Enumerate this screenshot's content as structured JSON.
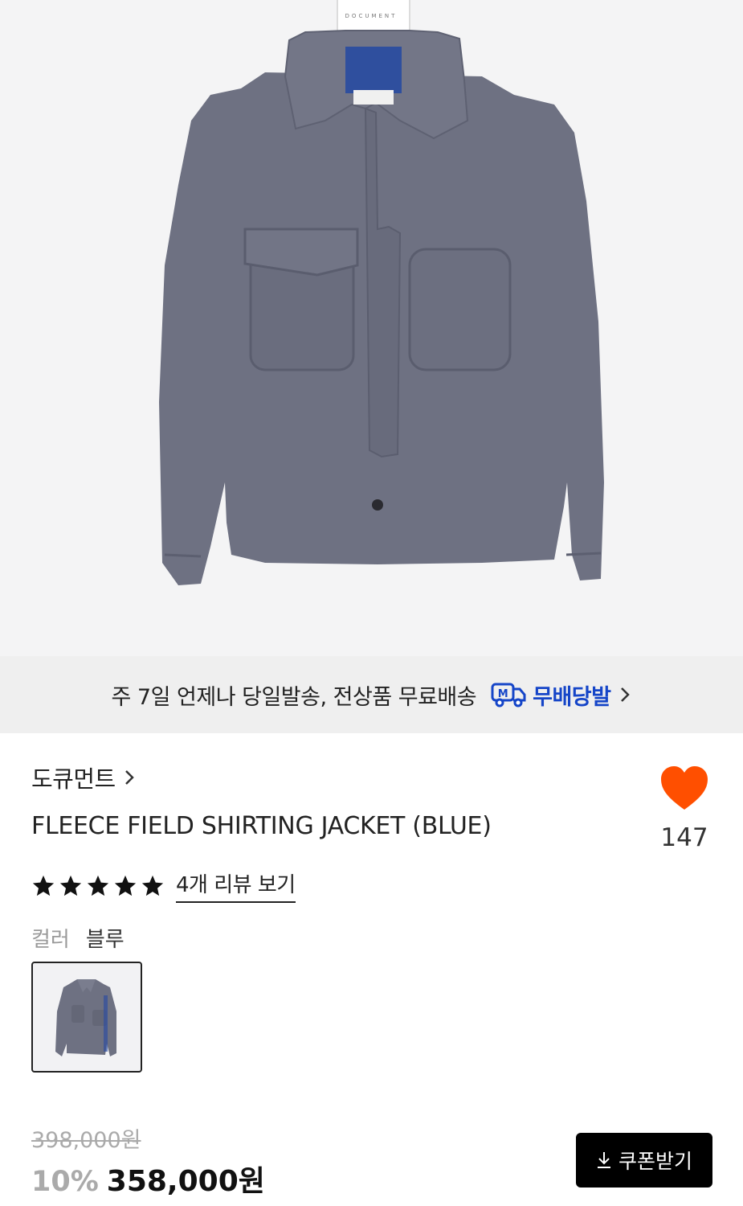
{
  "hero": {
    "image_label": "DOCUMENT"
  },
  "banner": {
    "text": "주 7일 언제나 당일발송, 전상품 무료배송",
    "brand": "무배당발",
    "truck_icon_letter": "M",
    "brand_color": "#1545c8",
    "icons": [
      "truck-icon",
      "chevron-right-icon"
    ]
  },
  "product": {
    "brand": "도큐먼트",
    "title": "FLEECE FIELD SHIRTING JACKET (BLUE)",
    "like_count": "147",
    "like_color": "#ff4f00",
    "rating_stars": 5,
    "review_link": "4개 리뷰 보기",
    "color_label": "컬러",
    "color_value": "블루",
    "original_price": "398,000원",
    "discount": "10%",
    "price": "358,000원"
  },
  "actions": {
    "coupon_label": "쿠폰받기"
  }
}
